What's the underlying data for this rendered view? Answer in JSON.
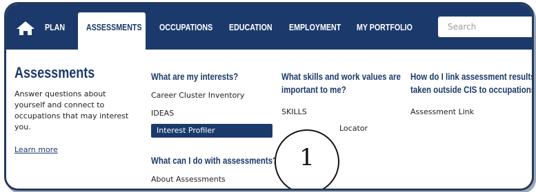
{
  "nav": {
    "items": [
      "PLAN",
      "ASSESSMENTS",
      "OCCUPATIONS",
      "EDUCATION",
      "EMPLOYMENT",
      "MY PORTFOLIO"
    ],
    "active": "ASSESSMENTS",
    "search_placeholder": "Search",
    "home_icon": "home-icon",
    "colors": {
      "nav_bg": "#1b3a6b",
      "active_bg": "#ffffff"
    }
  },
  "intro": {
    "title": "Assessments",
    "text": "Answer questions about yourself and connect to occupations that may interest you.",
    "learn_more": "Learn more"
  },
  "col1": {
    "heading": "What are my interests?",
    "links": [
      "Career Cluster Inventory",
      "IDEAS",
      "Interest Profiler"
    ],
    "heading2": "What can I do with assessments?",
    "links2": [
      "About Assessments"
    ]
  },
  "col2": {
    "heading": "What skills and work values are important to me?",
    "links": [
      "SKILLS",
      "Locator"
    ]
  },
  "col3": {
    "heading": "How do I link assessment results taken outside CIS to occupations?",
    "links": [
      "Assessment Link"
    ]
  },
  "callout": {
    "label": "1"
  }
}
